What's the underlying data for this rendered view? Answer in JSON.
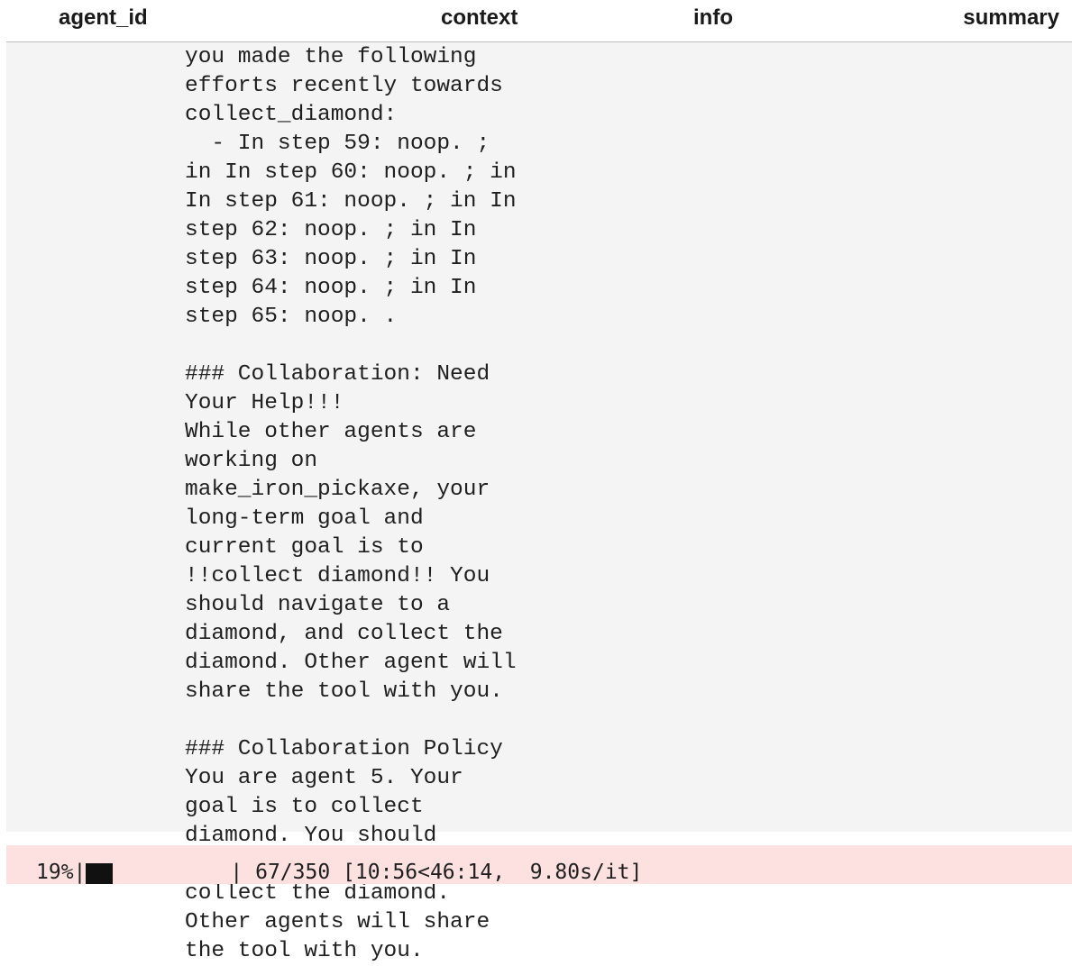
{
  "table": {
    "columns": {
      "agent_id": "agent_id",
      "context": "context",
      "info": "info",
      "summary": "summary"
    },
    "row": {
      "context": "you made the following efforts recently towards collect_diamond:\n  - In step 59: noop. ; in In step 60: noop. ; in In step 61: noop. ; in In step 62: noop. ; in In step 63: noop. ; in In step 64: noop. ; in In step 65: noop. .\n\n### Collaboration: Need Your Help!!!\nWhile other agents are working on make_iron_pickaxe, your long-term goal and current goal is to !!collect diamond!! You should navigate to a diamond, and collect the diamond. Other agent will share the tool with you.\n\n### Collaboration Policy\nYou are agent 5. Your goal is to collect diamond. You should navigate to a dimond and collect the diamond. Other agents will share the tool with you."
    }
  },
  "progress": {
    "percent_text": "19%|",
    "fraction": 0.19,
    "separator": "| ",
    "stats_text": "67/350 [10:56<46:14,  9.80s/it]"
  },
  "colors": {
    "row_background": "#f4f4f4",
    "progress_background": "#fde0e0",
    "bar_fill": "#111111"
  }
}
